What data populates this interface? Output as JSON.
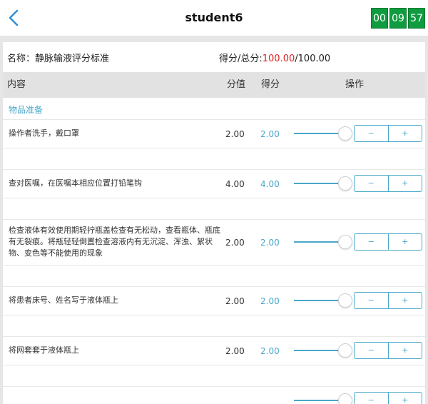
{
  "header": {
    "title": "student6",
    "timer": [
      "00",
      "09",
      "57"
    ]
  },
  "info": {
    "name_label": "名称：",
    "name_value": "静脉输液评分标准",
    "score_label": "得分/总分:",
    "score_got": "100.00",
    "score_sep": "/",
    "score_total": "100.00"
  },
  "table": {
    "headers": {
      "content": "内容",
      "value": "分值",
      "score": "得分",
      "action": "操作"
    },
    "section": "物品准备",
    "minus_label": "−",
    "plus_label": "+",
    "rows": [
      {
        "content": "操作者洗手，戴口罩",
        "value": "2.00",
        "score": "2.00"
      },
      {
        "content": "查对医嘱，在医嘱本相应位置打铅笔钩",
        "value": "4.00",
        "score": "4.00"
      },
      {
        "content": "检查液体有效使用期轻拧瓶盖检查有无松动，查看瓶体、瓶底有无裂痕。将瓶轻轻倒置检查溶液内有无沉淀、浑浊、絮状物、变色等不能使用的现象",
        "value": "2.00",
        "score": "2.00"
      },
      {
        "content": "将患者床号、姓名写于液体瓶上",
        "value": "2.00",
        "score": "2.00"
      },
      {
        "content": "将网套套于液体瓶上",
        "value": "2.00",
        "score": "2.00"
      },
      {
        "content": "",
        "value": "",
        "score": ""
      }
    ]
  }
}
